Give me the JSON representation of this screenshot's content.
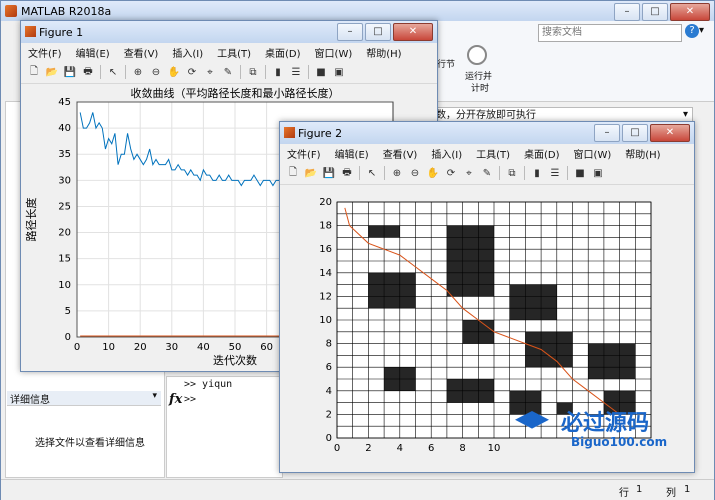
{
  "main_window": {
    "title": "MATLAB R2018a",
    "search_placeholder": "搜索文档",
    "ribbon_btn1_l1": "行节",
    "ribbon_btn2_l1": "运行并",
    "ribbon_btn2_l2": "计时",
    "status_hint": "数，分开存放即可执行",
    "detail_header": "详细信息",
    "detail_hint": "选择文件以查看详细信息",
    "cmd_line1": ">> yiqun",
    "cmd_prompt": ">>",
    "fx": "fx",
    "status_row_label": "行",
    "status_row_value": "1",
    "status_col_label": "列",
    "status_col_value": "1"
  },
  "figure1": {
    "title": "Figure 1",
    "menu": [
      "文件(F)",
      "编辑(E)",
      "查看(V)",
      "插入(I)",
      "工具(T)",
      "桌面(D)",
      "窗口(W)",
      "帮助(H)"
    ]
  },
  "figure2": {
    "title": "Figure 2",
    "menu": [
      "文件(F)",
      "编辑(E)",
      "查看(V)",
      "插入(I)",
      "工具(T)",
      "桌面(D)",
      "窗口(W)",
      "帮助(H)"
    ]
  },
  "watermark": {
    "text": "必过源码",
    "sub": "Biguo100.com"
  },
  "chart_data": [
    {
      "type": "line",
      "title": "收敛曲线（平均路径长度和最小路径长度）",
      "xlabel": "迭代次数",
      "ylabel": "路径长度",
      "xlim": [
        0,
        100
      ],
      "ylim": [
        0,
        45
      ],
      "xticks": [
        0,
        10,
        20,
        30,
        40,
        50,
        60
      ],
      "yticks": [
        0,
        5,
        10,
        15,
        20,
        25,
        30,
        35,
        40,
        45
      ],
      "grid": true,
      "series": [
        {
          "color": "#0072bd",
          "x": [
            1,
            2,
            3,
            4,
            5,
            6,
            7,
            8,
            9,
            10,
            11,
            12,
            13,
            14,
            15,
            16,
            17,
            18,
            19,
            20,
            21,
            22,
            23,
            24,
            25,
            26,
            27,
            28,
            29,
            30,
            31,
            32,
            33,
            34,
            35,
            36,
            37,
            38,
            39,
            40,
            41,
            42,
            43,
            44,
            45,
            46,
            47,
            48,
            49,
            50,
            51,
            52,
            53,
            54,
            55,
            56,
            57,
            58,
            59,
            60,
            61,
            62,
            63,
            64,
            65,
            66,
            67,
            68,
            69,
            70
          ],
          "y": [
            43,
            40,
            40,
            41,
            43,
            40,
            41,
            40,
            36,
            38,
            37,
            39,
            33,
            35,
            35,
            39,
            36,
            34,
            35,
            34,
            33,
            34,
            36,
            33,
            34,
            33,
            33,
            33,
            34,
            32,
            32,
            33,
            32,
            32,
            31,
            32,
            31,
            31,
            30,
            32,
            31,
            31,
            30,
            30,
            31,
            30,
            30,
            31,
            30,
            30,
            30,
            29,
            30,
            30,
            30,
            31,
            30,
            29,
            30,
            30,
            30,
            29,
            30,
            30,
            31,
            30,
            30,
            30,
            29,
            30
          ]
        },
        {
          "color": "#d95319",
          "x": [
            1,
            70
          ],
          "y": [
            0.2,
            0.2
          ]
        }
      ]
    },
    {
      "type": "heatmap",
      "xlim": [
        0,
        20
      ],
      "ylim": [
        0,
        20
      ],
      "xticks": [
        0,
        2,
        4,
        6,
        8,
        10
      ],
      "yticks": [
        0,
        2,
        4,
        6,
        8,
        10,
        12,
        14,
        16,
        18,
        20
      ],
      "obstacles": [
        [
          2,
          17
        ],
        [
          3,
          17
        ],
        [
          2,
          13
        ],
        [
          3,
          13
        ],
        [
          4,
          13
        ],
        [
          2,
          12
        ],
        [
          3,
          12
        ],
        [
          4,
          12
        ],
        [
          2,
          11
        ],
        [
          3,
          11
        ],
        [
          4,
          11
        ],
        [
          7,
          17
        ],
        [
          8,
          17
        ],
        [
          9,
          17
        ],
        [
          7,
          16
        ],
        [
          8,
          16
        ],
        [
          9,
          16
        ],
        [
          7,
          15
        ],
        [
          8,
          15
        ],
        [
          9,
          15
        ],
        [
          7,
          14
        ],
        [
          8,
          14
        ],
        [
          9,
          14
        ],
        [
          7,
          13
        ],
        [
          8,
          13
        ],
        [
          9,
          13
        ],
        [
          7,
          12
        ],
        [
          8,
          12
        ],
        [
          9,
          12
        ],
        [
          11,
          12
        ],
        [
          12,
          12
        ],
        [
          13,
          12
        ],
        [
          11,
          11
        ],
        [
          12,
          11
        ],
        [
          13,
          11
        ],
        [
          11,
          10
        ],
        [
          12,
          10
        ],
        [
          13,
          10
        ],
        [
          8,
          9
        ],
        [
          9,
          9
        ],
        [
          8,
          8
        ],
        [
          9,
          8
        ],
        [
          12,
          8
        ],
        [
          13,
          8
        ],
        [
          14,
          8
        ],
        [
          12,
          7
        ],
        [
          13,
          7
        ],
        [
          14,
          7
        ],
        [
          12,
          6
        ],
        [
          13,
          6
        ],
        [
          14,
          6
        ],
        [
          16,
          7
        ],
        [
          17,
          7
        ],
        [
          18,
          7
        ],
        [
          16,
          6
        ],
        [
          17,
          6
        ],
        [
          18,
          6
        ],
        [
          16,
          5
        ],
        [
          17,
          5
        ],
        [
          18,
          5
        ],
        [
          3,
          5
        ],
        [
          4,
          5
        ],
        [
          3,
          4
        ],
        [
          4,
          4
        ],
        [
          7,
          4
        ],
        [
          8,
          4
        ],
        [
          9,
          4
        ],
        [
          7,
          3
        ],
        [
          8,
          3
        ],
        [
          9,
          3
        ],
        [
          11,
          3
        ],
        [
          12,
          3
        ],
        [
          11,
          2
        ],
        [
          12,
          2
        ],
        [
          14,
          2
        ],
        [
          17,
          3
        ],
        [
          18,
          3
        ],
        [
          17,
          2
        ],
        [
          18,
          2
        ]
      ],
      "path": {
        "color": "#d95319",
        "x": [
          0.5,
          0.8,
          1.2,
          2,
          3,
          4,
          5,
          6,
          7,
          8,
          9,
          10,
          11,
          12,
          13,
          14,
          15,
          16,
          17,
          18
        ],
        "y": [
          19.5,
          18,
          17.5,
          16.5,
          16,
          15.5,
          14.5,
          13.5,
          12.5,
          11,
          10,
          9,
          8.5,
          8,
          7.5,
          6.5,
          5,
          4,
          3,
          2
        ]
      }
    }
  ]
}
